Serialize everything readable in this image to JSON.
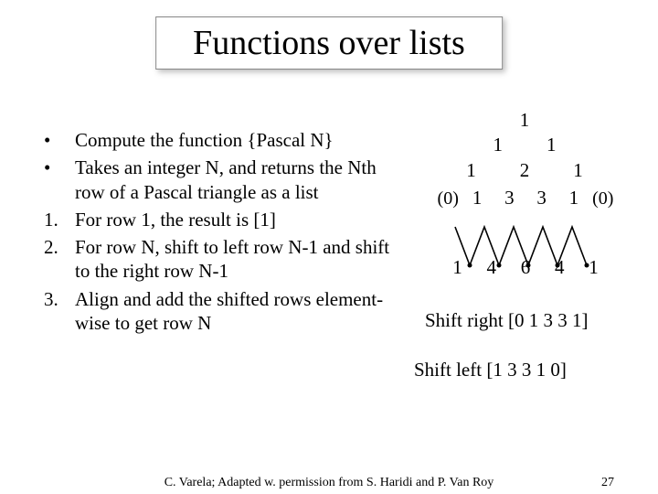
{
  "title": "Functions over lists",
  "bullets": [
    {
      "marker": "•",
      "text": "Compute the function {Pascal N}"
    },
    {
      "marker": "•",
      "text": "Takes an integer N, and returns the Nth row of a Pascal triangle as a list"
    },
    {
      "marker": "1.",
      "text": "For row 1, the result is [1]"
    },
    {
      "marker": "2.",
      "text": "For row N, shift to left row N-1 and shift to the right row N-1"
    },
    {
      "marker": "3.",
      "text": "Align and add the shifted rows element-wise to get row N"
    }
  ],
  "triangle": {
    "row1": "1",
    "row2": "1  1",
    "row3": "1  2  1",
    "row4": {
      "left0": "(0)",
      "n1": "1",
      "n2": "3",
      "n3": "3",
      "n4": "1",
      "right0": "(0)"
    },
    "row5": {
      "n1": "1",
      "n2": "4",
      "n3": "6",
      "n4": "4",
      "n5": "1"
    }
  },
  "shift_right_label": "Shift right",
  "shift_right_seq": "[0 1 3 3 1]",
  "shift_left_label": "Shift left",
  "shift_left_seq": "[1 3 3 1 0]",
  "footer_credit": "C. Varela;  Adapted w. permission from S. Haridi and P. Van Roy",
  "footer_page": "27"
}
